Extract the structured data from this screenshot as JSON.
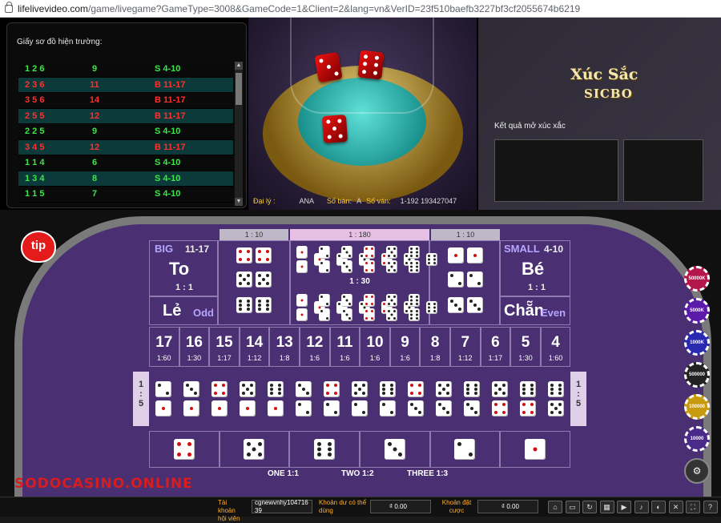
{
  "browser": {
    "url_host": "lifelivevideo.com",
    "url_path": "/game/livegame?GameType=3008&GameCode=1&Client=2&lang=vn&VerID=23f510baefb3227bf3cf2055674b6219"
  },
  "roadmap": {
    "title": "Giấy sơ đồ hiện trường:",
    "rows": [
      {
        "dice": "1 2 6",
        "sum": "9",
        "result": "S 4-10",
        "color": "green"
      },
      {
        "dice": "2 3 6",
        "sum": "11",
        "result": "B 11-17",
        "color": "red"
      },
      {
        "dice": "3 5 6",
        "sum": "14",
        "result": "B 11-17",
        "color": "red"
      },
      {
        "dice": "2 5 5",
        "sum": "12",
        "result": "B 11-17",
        "color": "red"
      },
      {
        "dice": "2 2 5",
        "sum": "9",
        "result": "S 4-10",
        "color": "green"
      },
      {
        "dice": "3 4 5",
        "sum": "12",
        "result": "B 11-17",
        "color": "red"
      },
      {
        "dice": "1 1 4",
        "sum": "6",
        "result": "S 4-10",
        "color": "green"
      },
      {
        "dice": "1 3 4",
        "sum": "8",
        "result": "S 4-10",
        "color": "green"
      },
      {
        "dice": "1 1 5",
        "sum": "7",
        "result": "S 4-10",
        "color": "green"
      }
    ]
  },
  "video": {
    "dealer_label": "Đại lý :",
    "dealer_value": "ANA",
    "table_label": "Số bàn:",
    "table_value": "A",
    "round_label": "Số ván:",
    "round_value": "1-192 193427047"
  },
  "logo": {
    "line1": "Xúc Sắc",
    "line2": "SICBO"
  },
  "results": {
    "label": "Kết quả mở xúc xắc"
  },
  "board": {
    "hdr_left": "1 : 10",
    "hdr_mid": "1 : 180",
    "hdr_right": "1 : 10",
    "mid_payout": "1 : 30",
    "big": {
      "label": "BIG",
      "range": "11-17",
      "name": "To",
      "payout": "1 : 1"
    },
    "small": {
      "label": "SMALL",
      "range": "4-10",
      "name": "Bé",
      "payout": "1 : 1"
    },
    "odd": {
      "name": "Lẻ",
      "en": "Odd"
    },
    "even": {
      "name": "Chẵn",
      "en": "Even"
    },
    "totals": [
      {
        "n": "17",
        "p": "1:60"
      },
      {
        "n": "16",
        "p": "1:30"
      },
      {
        "n": "15",
        "p": "1:17"
      },
      {
        "n": "14",
        "p": "1:12"
      },
      {
        "n": "13",
        "p": "1:8"
      },
      {
        "n": "12",
        "p": "1:6"
      },
      {
        "n": "11",
        "p": "1:6"
      },
      {
        "n": "10",
        "p": "1:6"
      },
      {
        "n": "9",
        "p": "1:6"
      },
      {
        "n": "8",
        "p": "1:8"
      },
      {
        "n": "7",
        "p": "1:12"
      },
      {
        "n": "6",
        "p": "1:17"
      },
      {
        "n": "5",
        "p": "1:30"
      },
      {
        "n": "4",
        "p": "1:60"
      }
    ],
    "side_left": [
      "1",
      ":",
      "5"
    ],
    "side_right": [
      "1",
      ":",
      "5"
    ],
    "footer": {
      "one": "ONE 1:1",
      "two": "TWO 1:2",
      "three": "THREE 1:3"
    }
  },
  "chips": [
    "50000K",
    "5000K",
    "1000K",
    "500000",
    "100000",
    "10000"
  ],
  "watermark": "SODOCASINO.ONLINE",
  "bottom": {
    "account_label": "Tài khoản hội viên",
    "account_value": "cgnewvnhy104716",
    "account_extra": "39",
    "balance_label": "Khoản dư có thể dùng",
    "balance_value": "₫ 0.00",
    "bet_label": "Khoản đặt cược",
    "bet_value": "₫ 0.00"
  }
}
